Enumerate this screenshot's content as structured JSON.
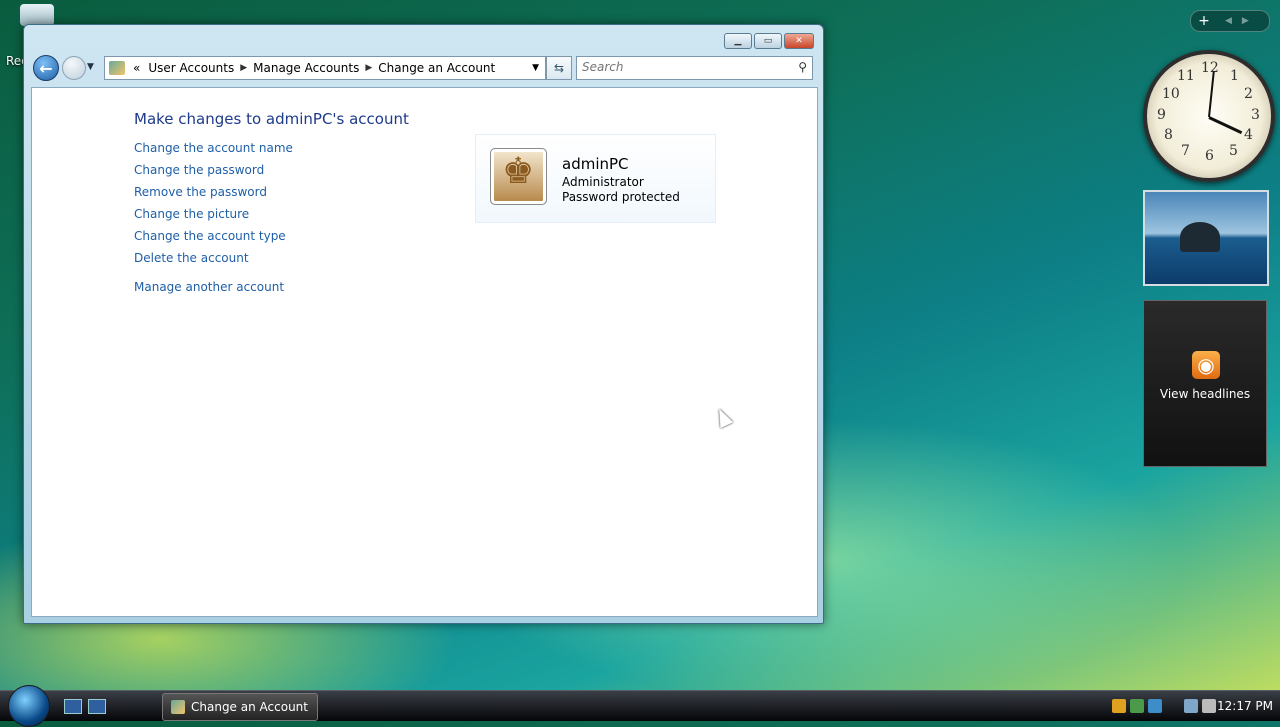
{
  "desktop": {
    "recycle_label": "Rec"
  },
  "window": {
    "address": {
      "chevron": "«",
      "crumbs": [
        "User Accounts",
        "Manage Accounts",
        "Change an Account"
      ]
    },
    "search": {
      "placeholder": "Search"
    },
    "heading": "Make changes to adminPC's account",
    "tasks": [
      "Change the account name",
      "Change the password",
      "Remove the password",
      "Change the picture",
      "Change the account type",
      "Delete the account"
    ],
    "other_task": "Manage another account",
    "account": {
      "name": "adminPC",
      "type": "Administrator",
      "status": "Password protected"
    }
  },
  "sidebar": {
    "clock_numbers": [
      "12",
      "1",
      "2",
      "3",
      "4",
      "5",
      "6",
      "7",
      "8",
      "9",
      "10",
      "11"
    ],
    "feed_label": "View headlines"
  },
  "taskbar": {
    "active_task": "Change an Account",
    "time": "12:17 PM"
  }
}
